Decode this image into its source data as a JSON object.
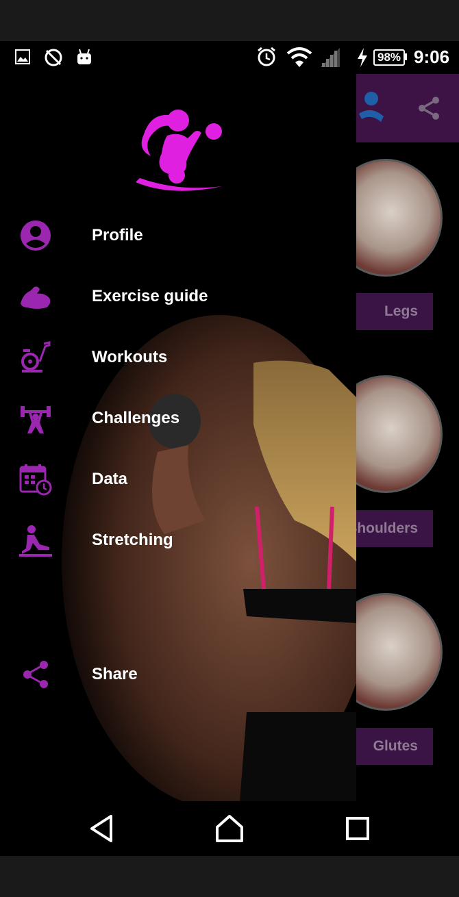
{
  "status_bar": {
    "left_icons": [
      "image-icon",
      "no-sync-icon",
      "android-icon"
    ],
    "right_icons": [
      "alarm-icon",
      "wifi-icon",
      "signal-icon",
      "charging-icon"
    ],
    "battery": "98%",
    "time": "9:06"
  },
  "drawer": {
    "logo": "fitness-woman-logo-icon",
    "items": [
      {
        "label": "Profile",
        "icon": "profile-icon"
      },
      {
        "label": "Exercise guide",
        "icon": "bicep-icon"
      },
      {
        "label": "Workouts",
        "icon": "exercise-bike-icon"
      },
      {
        "label": "Challenges",
        "icon": "weightlifter-icon"
      },
      {
        "label": "Data",
        "icon": "calendar-clock-icon"
      },
      {
        "label": "Stretching",
        "icon": "stretching-icon"
      }
    ],
    "share": {
      "label": "Share",
      "icon": "share-icon"
    }
  },
  "background_app": {
    "share_icon": "share-icon",
    "categories": [
      {
        "label": "Legs"
      },
      {
        "label": "Shoulders"
      },
      {
        "label": "Glutes"
      }
    ]
  },
  "nav_bar": {
    "back": "back-icon",
    "home": "home-icon",
    "recents": "recents-icon"
  },
  "colors": {
    "accent": "#9b27b0",
    "logo": "#e020e0",
    "toolbar": "#3d1346",
    "button_bg": "#3b1446"
  }
}
